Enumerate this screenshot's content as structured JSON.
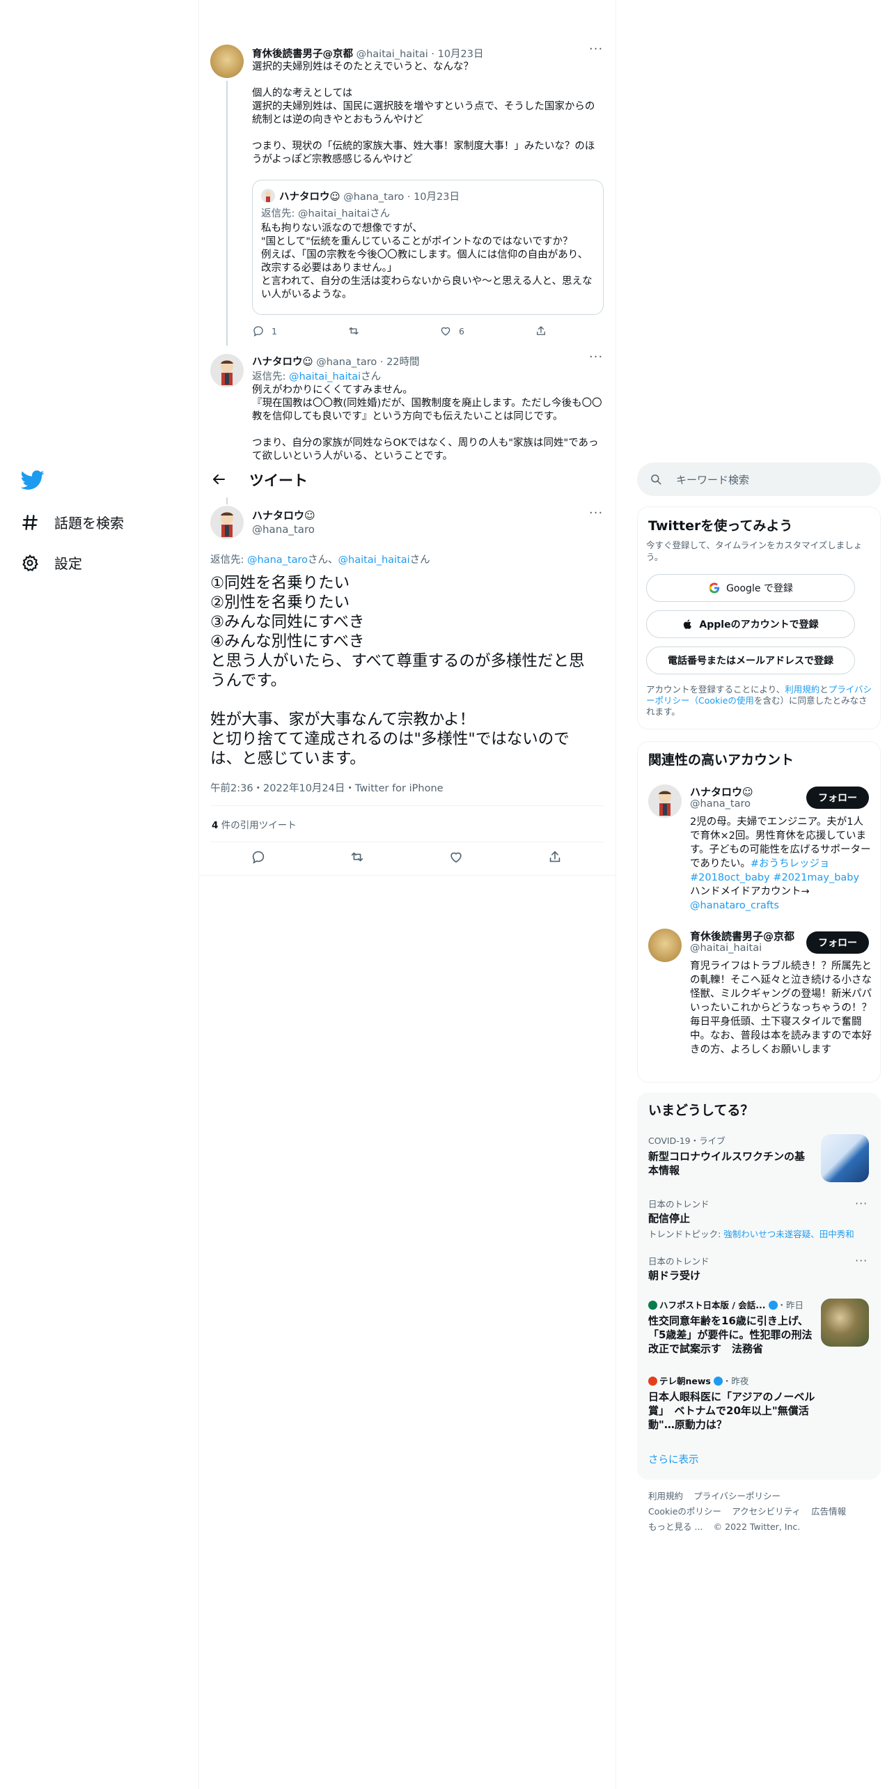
{
  "nav": {
    "explore": "話題を検索",
    "settings": "設定"
  },
  "header": {
    "title": "ツイート"
  },
  "thread": {
    "tweet1": {
      "name": "育休後読書男子@京都",
      "handle": "@haitai_haitai",
      "date": "10月23日",
      "text": "選択的夫婦別姓はそのたとえでいうと、なんな？\n\n個人的な考えとしては\n選択的夫婦別姓は、国民に選択肢を増やすという点で、そうした国家からの統制とは逆の向きやとおもうんやけど\n\nつまり、現状の「伝統的家族大事、姓大事！家制度大事！」みたいな？のほうがよっぽど宗教感感じるんやけど",
      "quote": {
        "name": "ハナタロウ☺",
        "handle": "@hana_taro",
        "date": "10月23日",
        "reply_prefix": "返信先: ",
        "reply_handle": "@haitai_haitai",
        "reply_suffix": "さん",
        "text": "私も拘りない派なので想像ですが、\n\"国として\"伝統を重んじていることがポイントなのではないですか？\n例えば、「国の宗教を今後〇〇教にします。個人には信仰の自由があり、改宗する必要はありません。」\nと言われて、自分の生活は変わらないから良いや〜と思える人と、思えない人がいるような。"
      },
      "reply_count": "1",
      "like_count": "6"
    },
    "tweet2": {
      "name": "ハナタロウ☺",
      "handle": "@hana_taro",
      "date": "22時間",
      "reply_prefix": "返信先: ",
      "reply_handle": "@haitai_haitai",
      "reply_suffix": "さん",
      "text": "例えがわかりにくくてすみません。\n『現在国教は〇〇教(同姓婚)だが、国教制度を廃止します。ただし今後も〇〇教を信仰しても良いです』という方向でも伝えたいことは同じです。\n\nつまり、自分の家族が同姓ならOKではなく、周りの人も\"家族は同姓\"であって欲しいという人がいる、ということです。"
    }
  },
  "main": {
    "name": "ハナタロウ☺",
    "handle": "@hana_taro",
    "reply_prefix": "返信先: ",
    "reply_handle1": "@hana_taro",
    "reply_mid": "さん、",
    "reply_handle2": "@haitai_haitai",
    "reply_suffix": "さん",
    "text": "①同姓を名乗りたい\n②別性を名乗りたい\n③みんな同姓にすべき\n④みんな別性にすべき\nと思う人がいたら、すべて尊重するのが多様性だと思うんです。\n\n姓が大事、家が大事なんて宗教かよ！\nと切り捨てて達成されるのは\"多様性\"ではないのでは、と感じています。",
    "meta": "午前2:36・2022年10月24日・Twitter for iPhone",
    "quote_count": "4",
    "quote_label": "件の引用ツイート"
  },
  "search": {
    "placeholder": "キーワード検索"
  },
  "signup": {
    "title": "Twitterを使ってみよう",
    "desc": "今すぐ登録して、タイムラインをカスタマイズしましょう。",
    "google": "Google で登録",
    "apple": "Appleのアカウントで登録",
    "phone": "電話番号またはメールアドレスで登録",
    "legal_pre": "アカウントを登録することにより、",
    "legal_terms": "利用規約",
    "legal_and": "と",
    "legal_privacy": "プライバシーポリシー（Cookieの使用",
    "legal_post": "を含む）に同意したとみなされます。"
  },
  "related": {
    "title": "関連性の高いアカウント",
    "follow": "フォロー",
    "accounts": [
      {
        "name": "ハナタロウ☺",
        "handle": "@hana_taro",
        "bio": "2児の母。夫婦でエンジニア。夫が1人で育休×2回。男性育休を応援しています。子どもの可能性を広げるサポーターでありたい。",
        "tags": "#おうちレッジョ #2018oct_baby #2021may_baby",
        "bio2": " ハンドメイドアカウント→ ",
        "link": "@hanataro_crafts"
      },
      {
        "name": "育休後読書男子@京都",
        "handle": "@haitai_haitai",
        "bio": "育児ライフはトラブル続き！？所属先との軋轢！そこへ延々と泣き続ける小さな怪獣、ミルクギャングの登場！新米パパいったいこれからどうなっちゃうの！？毎日平身低頭、土下寝スタイルで奮闘中。なお、普段は本を読みますので本好きの方、よろしくお願いします"
      }
    ]
  },
  "trends": {
    "title": "いまどうしてる？",
    "items": [
      {
        "context": "COVID-19・ライブ",
        "title": "新型コロナウイルスワクチンの基本情報"
      },
      {
        "context": "日本のトレンド",
        "title": "配信停止",
        "topic_label": "トレンドトピック: ",
        "topic": "強制わいせつ未遂容疑、田中秀和"
      },
      {
        "context": "日本のトレンド",
        "title": "朝ドラ受け"
      },
      {
        "source": "ハフポスト日本版 / 会話...",
        "time": "・昨日",
        "title": "性交同意年齢を16歳に引き上げ、「5歳差」が要件に。性犯罪の刑法改正で試案示す　法務省"
      },
      {
        "source": "テレ朝news",
        "time": "・昨夜",
        "title": "日本人眼科医に「アジアのノーベル賞」　ベトナムで20年以上\"無償活動\"…原動力は？"
      }
    ],
    "more": "さらに表示"
  },
  "footer": {
    "terms": "利用規約",
    "privacy": "プライバシーポリシー",
    "cookie": "Cookieのポリシー",
    "accessibility": "アクセシビリティ",
    "ads": "広告情報",
    "more": "もっと見る ...",
    "copyright": "© 2022 Twitter, Inc."
  },
  "colors": {
    "accent": "#1d9bf0",
    "text": "#0f1419",
    "muted": "#536471",
    "border": "#eff3f4"
  }
}
